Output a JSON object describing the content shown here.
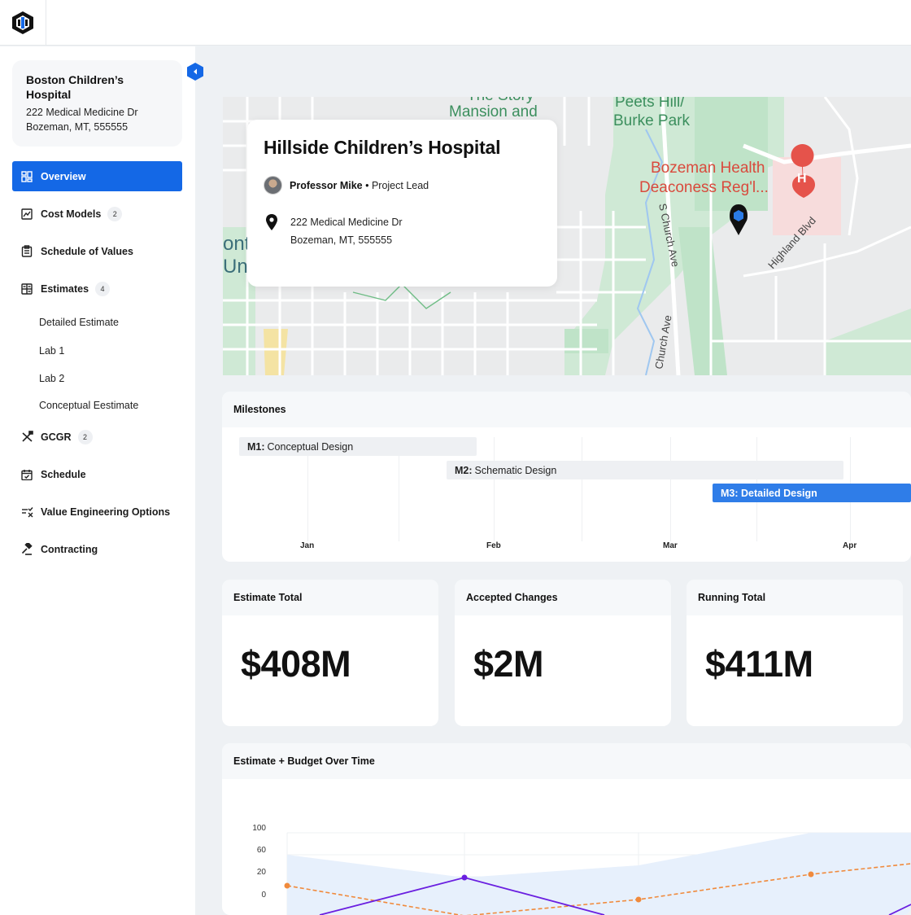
{
  "sidebar": {
    "project": {
      "title": "Boston Children’s Hospital",
      "address_line1": "222 Medical Medicine Dr",
      "address_line2": "Bozeman, MT, 555555"
    },
    "nav": [
      {
        "label": "Overview",
        "icon": "grid-icon",
        "active": true
      },
      {
        "label": "Cost Models",
        "icon": "chart-doc-icon",
        "badge": "2"
      },
      {
        "label": "Schedule of Values",
        "icon": "clipboard-icon"
      },
      {
        "label": "Estimates",
        "icon": "calculator-icon",
        "badge": "4"
      },
      {
        "label": "GCGR",
        "icon": "tools-icon",
        "badge": "2"
      },
      {
        "label": "Schedule",
        "icon": "calendar-icon"
      },
      {
        "label": "Value Engineering Options",
        "icon": "list-check-icon"
      },
      {
        "label": "Contracting",
        "icon": "gavel-icon"
      }
    ],
    "sub_items": [
      "Detailed Estimate",
      "Lab 1",
      "Lab 2",
      "Conceptual Eestimate"
    ]
  },
  "map": {
    "card_title": "Hillside Children’s Hospital",
    "lead_name": "Professor Mike",
    "lead_role": "Project Lead",
    "address_line1": "222 Medical Medicine Dr",
    "address_line2": "Bozeman, MT, 555555",
    "labels": [
      "The Story",
      "Mansion and",
      "Peets Hill/",
      "Burke Park",
      "Bozeman Health",
      "Deaconess Reg'l...",
      "S Church Ave",
      "Highland Blvd",
      "Church Ave",
      "ont",
      "Un"
    ]
  },
  "milestones": {
    "title": "Milestones",
    "items": [
      {
        "code": "M1:",
        "name": "Conceptual Design",
        "highlight": false
      },
      {
        "code": "M2:",
        "name": "Schematic Design",
        "highlight": false
      },
      {
        "code": "M3:",
        "name": "Detailed Design",
        "highlight": true
      }
    ],
    "months": [
      "Jan",
      "Feb",
      "Mar",
      "Apr"
    ]
  },
  "stats": [
    {
      "label": "Estimate Total",
      "value": "$408M"
    },
    {
      "label": "Accepted Changes",
      "value": "$2M"
    },
    {
      "label": "Running Total",
      "value": "$411M"
    }
  ],
  "budget_chart": {
    "title": "Estimate + Budget Over Time",
    "y_ticks": [
      "100",
      "60",
      "20",
      "0"
    ]
  },
  "colors": {
    "accent": "#1468e6",
    "series_orange": "#f08a3c",
    "series_purple": "#6a1fe0",
    "band": "#e7f0fc"
  }
}
